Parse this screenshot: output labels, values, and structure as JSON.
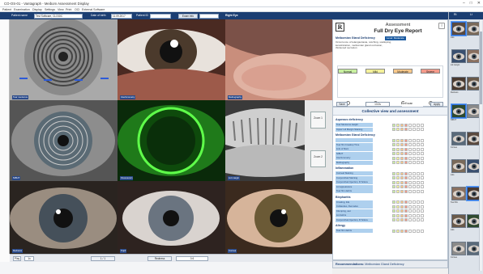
{
  "window": {
    "title": "CO-OS-01 - Vantagraph - Meibom Assessment Display",
    "controls": [
      "minimize-icon",
      "maximize-icon",
      "close-icon"
    ]
  },
  "menu": [
    "Patient",
    "Examination",
    "Display",
    "Settings",
    "View",
    "Print",
    "OCI",
    "External Software"
  ],
  "patient_bar": {
    "name_label": "Patient name",
    "name_value": "Test Software, CLOGIC",
    "dob_label": "Date of birth",
    "dob_value": "11.09.2017",
    "id_label": "Patient ID",
    "id_value": "",
    "exam_label": "Exam info",
    "exam_value": "",
    "eye_label": "Right Eye"
  },
  "image_captions": [
    "Tear meniscus",
    "Interferometry",
    "Meibography",
    "NIBUT",
    "Fluorescein",
    "Lid margin",
    "Redness",
    "Pupil",
    "Cornea"
  ],
  "compare_buttons": [
    {
      "label": "Zoom 1"
    },
    {
      "label": "Zoom 2"
    }
  ],
  "bottom_bar": {
    "play": "Play",
    "speed": "1x",
    "scale": "Redness",
    "value": "0.6",
    "page": "1 / 1"
  },
  "report": {
    "logo": "R",
    "title": "Assessment",
    "subtitle": "Full Dry Eye Report",
    "info_icon": "i",
    "section": "Meibomian Gland Deficiency",
    "section_badge": "Level: Moderate",
    "description": "Occurrence of telangiectasia, notching, scalloping, keratinization, meibomian gland occlusion, thickened secretion",
    "severity": [
      {
        "label": "Normal",
        "color": "#c8f0a0"
      },
      {
        "label": "Mild",
        "color": "#f4f19a"
      },
      {
        "label": "Moderate",
        "color": "#f8c88a"
      },
      {
        "label": "Severe",
        "color": "#f49a8a"
      }
    ],
    "save_label": "Save",
    "value_label": "13.0s",
    "self_scan_label": "Self scan",
    "apply_label": "Apply"
  },
  "collective": {
    "title": "Collective view and assessment",
    "categories": [
      {
        "name": "Aqueous deficiency",
        "rows": [
          "Tear Meniscus Height",
          "Upper Lid Margin Staining"
        ]
      },
      {
        "name": "Meibomian Gland Deficiency",
        "rows": [
          "",
          "Tear film breakup Time",
          "Lids of Marx",
          "NIBUT",
          "Interferometry",
          "Meibography"
        ]
      },
      {
        "name": "Inflammation",
        "rows": [
          "Corneal Staining",
          "Conjunctival Staining",
          "Conjunctival Injection, R Sclera",
          "Lid appearance",
          "Tear film debris"
        ]
      },
      {
        "name": "Blepharitis",
        "rows": [
          "Crusting, lids",
          "Collarettes, Demodex",
          "Clumping, wet",
          "Lid debris",
          "Conjunctival Injection, R Sclera"
        ]
      },
      {
        "name": "Allergy",
        "rows": [
          "Tear film debris"
        ]
      }
    ]
  },
  "recommendation": {
    "prefix": "Recommendations:",
    "value": "Meibomian Gland Deficiency"
  },
  "right_panel": {
    "tabs": [
      "Rt",
      "Lt"
    ],
    "thumb_labels": [
      "Meibography",
      "Lids",
      "Tear film",
      "Lid margin",
      "Lids",
      "Redness",
      "Tear film",
      "NIBUT",
      "Fluorescein",
      "Cornea",
      "Meibography",
      "Lids",
      "Pupil",
      "Tear film",
      "Lid margin",
      "Lids",
      "Redness",
      "Cornea"
    ]
  }
}
